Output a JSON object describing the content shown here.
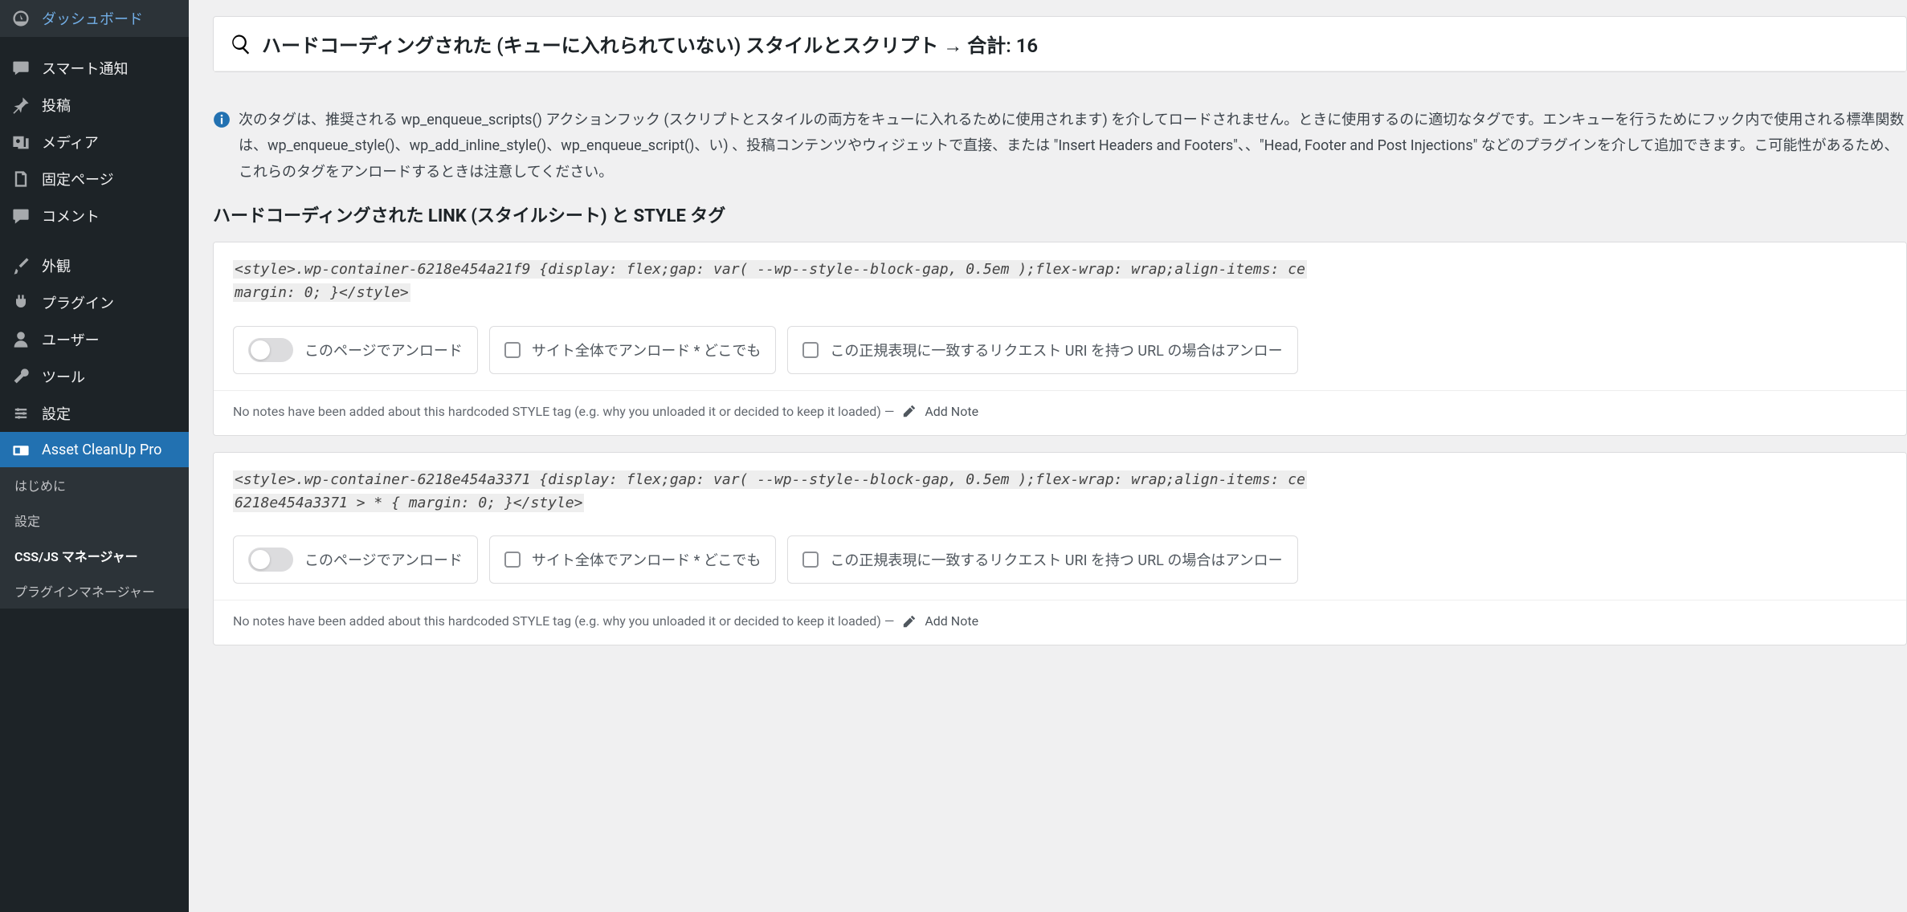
{
  "sidebar": {
    "items": [
      {
        "key": "dashboard",
        "label": "ダッシュボード",
        "icon": "dashboard-icon"
      },
      {
        "key": "smart",
        "label": "スマート通知",
        "icon": "chat-icon"
      },
      {
        "key": "posts",
        "label": "投稿",
        "icon": "pin-icon"
      },
      {
        "key": "media",
        "label": "メディア",
        "icon": "media-icon"
      },
      {
        "key": "pages",
        "label": "固定ページ",
        "icon": "pages-icon"
      },
      {
        "key": "comments",
        "label": "コメント",
        "icon": "comment-icon"
      },
      {
        "key": "appearance",
        "label": "外観",
        "icon": "brush-icon"
      },
      {
        "key": "plugins",
        "label": "プラグイン",
        "icon": "plug-icon"
      },
      {
        "key": "users",
        "label": "ユーザー",
        "icon": "user-icon"
      },
      {
        "key": "tools",
        "label": "ツール",
        "icon": "wrench-icon"
      },
      {
        "key": "settings",
        "label": "設定",
        "icon": "settings-icon"
      },
      {
        "key": "asset-cleanup",
        "label": "Asset CleanUp Pro",
        "icon": "asset-icon"
      }
    ],
    "submenu": [
      {
        "label": "はじめに",
        "current": false
      },
      {
        "label": "設定",
        "current": false
      },
      {
        "label": "CSS/JS マネージャー",
        "current": true
      },
      {
        "label": "プラグインマネージャー",
        "current": false
      }
    ]
  },
  "panel": {
    "title": "ハードコーディングされた (キューに入れられていない) スタイルとスクリプト → 合計: 16"
  },
  "info": {
    "text": "次のタグは、推奨される wp_enqueue_scripts() アクションフック (スクリプトとスタイルの両方をキューに入れるために使用されます) を介してロードされません。ときに使用するのに適切なタグです。エンキューを行うためにフック内で使用される標準関数は、wp_enqueue_style()、wp_add_inline_style()、wp_enqueue_script()、い) 、投稿コンテンツやウィジェットで直接、または \"Insert Headers and Footers\"、、\"Head, Footer and Post Injections\" などのプラグインを介して追加できます。こ可能性があるため、これらのタグをアンロードするときは注意してください。"
  },
  "section_title": "ハードコーディングされた LINK (スタイルシート) と STYLE タグ",
  "cards": [
    {
      "code_line1": "<style>.wp-container-6218e454a21f9 {display: flex;gap: var( --wp--style--block-gap, 0.5em );flex-wrap: wrap;align-items: ce",
      "code_line2": "margin: 0; }</style>",
      "unload_page": "このページでアンロード",
      "unload_site": "サイト全体でアンロード * どこでも",
      "unload_regex": "この正規表現に一致するリクエスト URI を持つ URL の場合はアンロー",
      "notes_text": "No notes have been added about this hardcoded STYLE tag (e.g. why you unloaded it or decided to keep it loaded) —",
      "add_note": "Add Note"
    },
    {
      "code_line1": "<style>.wp-container-6218e454a3371 {display: flex;gap: var( --wp--style--block-gap, 0.5em );flex-wrap: wrap;align-items: ce",
      "code_line2": "6218e454a3371 > * { margin: 0; }</style>",
      "unload_page": "このページでアンロード",
      "unload_site": "サイト全体でアンロード * どこでも",
      "unload_regex": "この正規表現に一致するリクエスト URI を持つ URL の場合はアンロー",
      "notes_text": "No notes have been added about this hardcoded STYLE tag (e.g. why you unloaded it or decided to keep it loaded) —",
      "add_note": "Add Note"
    }
  ]
}
